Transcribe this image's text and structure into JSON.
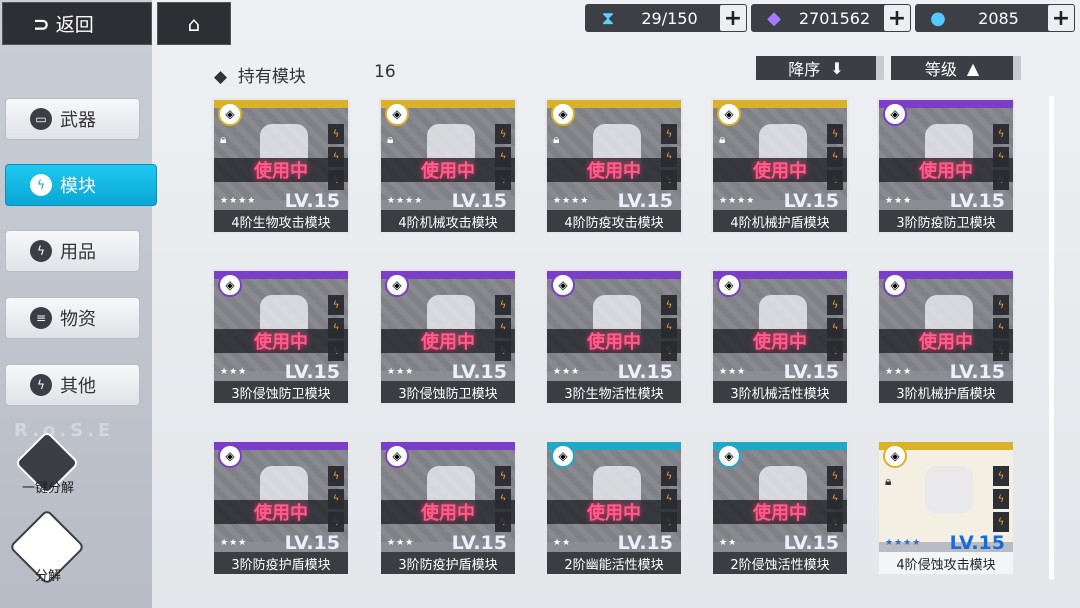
{
  "topbar": {
    "back_label": "返回",
    "resources": [
      {
        "icon": "hourglass-icon",
        "value": "29/150",
        "color": "#5ad0ff"
      },
      {
        "icon": "purple-crystal-icon",
        "value": "2701562",
        "color": "#a67bff"
      },
      {
        "icon": "blue-orb-icon",
        "value": "2085",
        "color": "#53c7ff"
      }
    ]
  },
  "sidebar": {
    "items": [
      {
        "label": "武器",
        "icon": "gun-icon"
      },
      {
        "label": "模块",
        "icon": "bolt-icon",
        "active": true
      },
      {
        "label": "用品",
        "icon": "bolt-icon"
      },
      {
        "label": "物资",
        "icon": "stack-icon"
      },
      {
        "label": "其他",
        "icon": "bolt-icon"
      }
    ],
    "watermark": "R.o.S.E",
    "one_click_label": "一键分解",
    "decompose_label": "分解"
  },
  "header": {
    "title": "持有模块",
    "count": "16",
    "sort_label": "降序",
    "level_label": "等级"
  },
  "colors": {
    "gold": "#d9b22a",
    "purple": "#7a3ec8",
    "teal": "#1fa9c7",
    "active": "#0aa7d6"
  },
  "cards": [
    {
      "name": "4阶生物攻击模块",
      "level": "LV.15",
      "stars": "★★★★",
      "top": "gold",
      "status": "使用中",
      "locked": true
    },
    {
      "name": "4阶机械攻击模块",
      "level": "LV.15",
      "stars": "★★★★",
      "top": "gold",
      "status": "使用中",
      "locked": true
    },
    {
      "name": "4阶防疫攻击模块",
      "level": "LV.15",
      "stars": "★★★★",
      "top": "gold",
      "status": "使用中",
      "locked": true
    },
    {
      "name": "4阶机械护盾模块",
      "level": "LV.15",
      "stars": "★★★★",
      "top": "gold",
      "status": "使用中",
      "locked": true
    },
    {
      "name": "3阶防疫防卫模块",
      "level": "LV.15",
      "stars": "★★★",
      "top": "purple",
      "status": "使用中",
      "locked": false
    },
    {
      "name": "3阶侵蚀防卫模块",
      "level": "LV.15",
      "stars": "★★★",
      "top": "purple",
      "status": "使用中",
      "locked": false
    },
    {
      "name": "3阶侵蚀防卫模块",
      "level": "LV.15",
      "stars": "★★★",
      "top": "purple",
      "status": "使用中",
      "locked": false
    },
    {
      "name": "3阶生物活性模块",
      "level": "LV.15",
      "stars": "★★★",
      "top": "purple",
      "status": "使用中",
      "locked": false
    },
    {
      "name": "3阶机械活性模块",
      "level": "LV.15",
      "stars": "★★★",
      "top": "purple",
      "status": "使用中",
      "locked": false
    },
    {
      "name": "3阶机械护盾模块",
      "level": "LV.15",
      "stars": "★★★",
      "top": "purple",
      "status": "使用中",
      "locked": false
    },
    {
      "name": "3阶防疫护盾模块",
      "level": "LV.15",
      "stars": "★★★",
      "top": "purple",
      "status": "使用中",
      "locked": false
    },
    {
      "name": "3阶防疫护盾模块",
      "level": "LV.15",
      "stars": "★★★",
      "top": "purple",
      "status": "使用中",
      "locked": false
    },
    {
      "name": "2阶幽能活性模块",
      "level": "LV.15",
      "stars": "★★",
      "top": "teal",
      "status": "使用中",
      "locked": false
    },
    {
      "name": "2阶侵蚀活性模块",
      "level": "LV.15",
      "stars": "★★",
      "top": "teal",
      "status": "使用中",
      "locked": false
    },
    {
      "name": "4阶侵蚀攻击模块",
      "level": "LV.15",
      "stars": "★★★★",
      "top": "gold",
      "status": "",
      "locked": true,
      "equipped": true
    }
  ]
}
